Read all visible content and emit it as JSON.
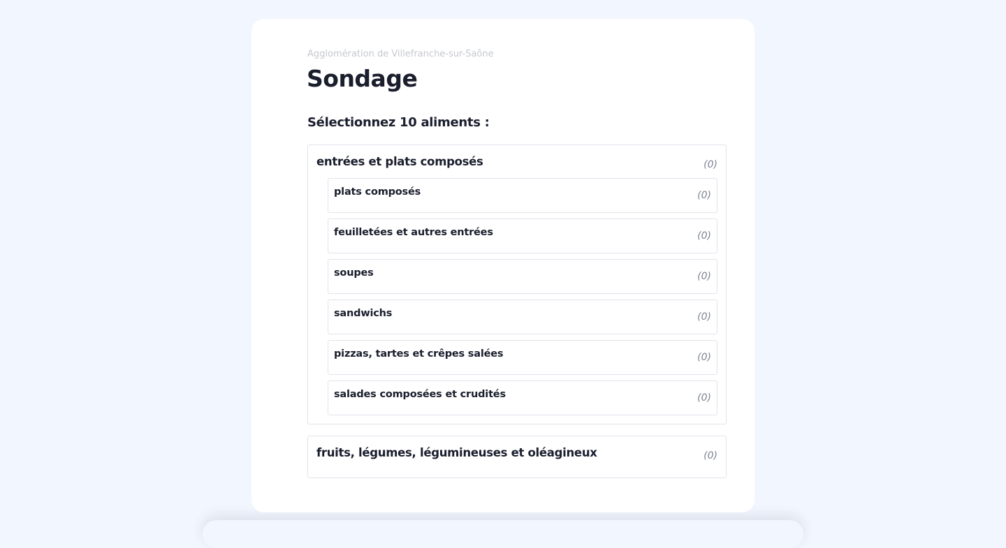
{
  "header": {
    "subtitle": "Agglomération de Villefranche-sur-Saône",
    "title": "Sondage"
  },
  "question": "Sélectionnez 10 aliments :",
  "categories": [
    {
      "label": "entrées et plats composés",
      "count": "(0)",
      "expanded": true,
      "subcategories": [
        {
          "label": "plats composés",
          "count": "(0)"
        },
        {
          "label": "feuilletées et autres entrées",
          "count": "(0)"
        },
        {
          "label": "soupes",
          "count": "(0)"
        },
        {
          "label": "sandwichs",
          "count": "(0)"
        },
        {
          "label": "pizzas, tartes et crêpes salées",
          "count": "(0)"
        },
        {
          "label": "salades composées et crudités",
          "count": "(0)"
        }
      ]
    },
    {
      "label": "fruits, légumes, légumineuses et oléagineux",
      "count": "(0)",
      "expanded": false
    }
  ],
  "colors": {
    "background": "#f2f6fe",
    "card": "#ffffff",
    "text": "#1a1e2d",
    "muted": "#c6c8cf",
    "count": "#7d8290",
    "border": "#dfe3ea"
  }
}
